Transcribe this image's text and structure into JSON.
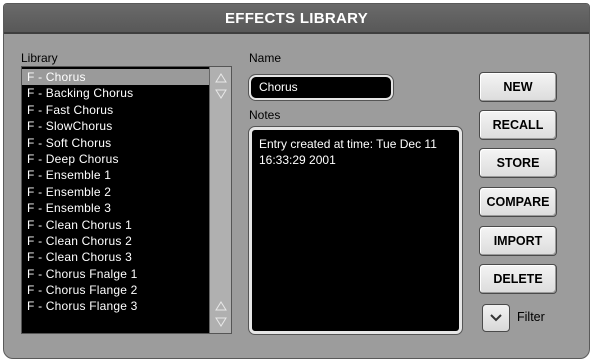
{
  "window": {
    "title": "EFFECTS LIBRARY"
  },
  "library": {
    "label": "Library",
    "items": [
      "F - Chorus",
      "F - Backing Chorus",
      "F - Fast Chorus",
      "F - SlowChorus",
      "F - Soft Chorus",
      "F - Deep Chorus",
      "F - Ensemble 1",
      "F - Ensemble 2",
      "F - Ensemble 3",
      "F - Clean Chorus 1",
      "F - Clean Chorus 2",
      "F - Clean Chorus 3",
      "F - Chorus Fnalge 1",
      "F - Chorus Flange 2",
      "F - Chorus Flange 3"
    ],
    "selected_index": 0
  },
  "name": {
    "label": "Name",
    "value": "Chorus"
  },
  "notes": {
    "label": "Notes",
    "value": "Entry created at time: Tue Dec 11 16:33:29 2001"
  },
  "buttons": {
    "new": "NEW",
    "recall": "RECALL",
    "store": "STORE",
    "compare": "COMPARE",
    "import": "IMPORT",
    "delete": "DELETE"
  },
  "filter": {
    "label": "Filter",
    "icon": "chevron-down-icon"
  },
  "colors": {
    "panel": "#9c9c9c",
    "titlebar": "#585858",
    "list_bg": "#000000",
    "selected_row": "#9a9a9a"
  }
}
